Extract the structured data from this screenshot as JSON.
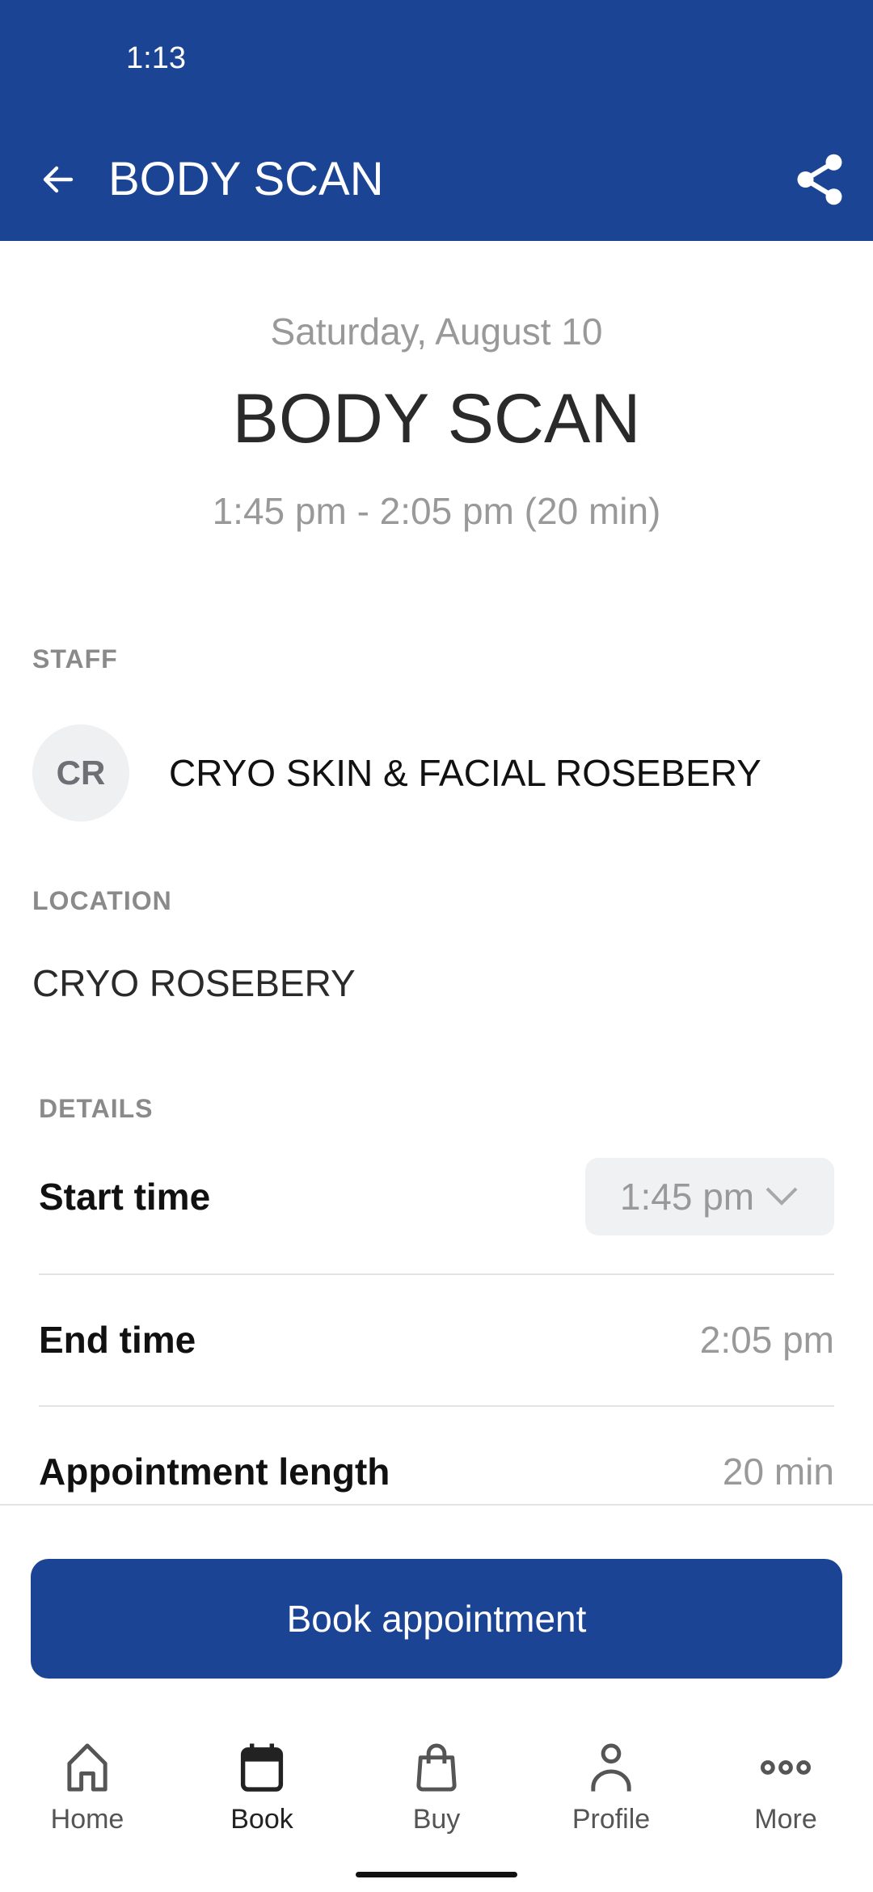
{
  "status_bar": {
    "time": "1:13"
  },
  "app_bar": {
    "title": "BODY SCAN",
    "back_icon": "arrow-left-icon",
    "share_icon": "share-icon"
  },
  "hero": {
    "date": "Saturday, August 10",
    "title": "BODY SCAN",
    "time_range": "1:45 pm - 2:05 pm (20 min)"
  },
  "staff": {
    "label": "STAFF",
    "initials": "CR",
    "name": "CRYO SKIN & FACIAL ROSEBERY"
  },
  "location": {
    "label": "LOCATION",
    "name": "CRYO ROSEBERY"
  },
  "details": {
    "label": "DETAILS",
    "rows": [
      {
        "label": "Start time",
        "value": "1:45 pm",
        "type": "dropdown"
      },
      {
        "label": "End time",
        "value": "2:05 pm"
      },
      {
        "label": "Appointment length",
        "value": "20 min"
      }
    ]
  },
  "actions": {
    "book_label": "Book appointment"
  },
  "colors": {
    "brand": "#1b4494",
    "muted_text": "#999999",
    "section_label": "#8a8a8a"
  },
  "nav": {
    "active": "Book",
    "items": [
      {
        "label": "Home",
        "icon": "home-icon"
      },
      {
        "label": "Book",
        "icon": "calendar-icon"
      },
      {
        "label": "Buy",
        "icon": "shopping-bag-icon"
      },
      {
        "label": "Profile",
        "icon": "person-icon"
      },
      {
        "label": "More",
        "icon": "more-dots-icon"
      }
    ]
  }
}
